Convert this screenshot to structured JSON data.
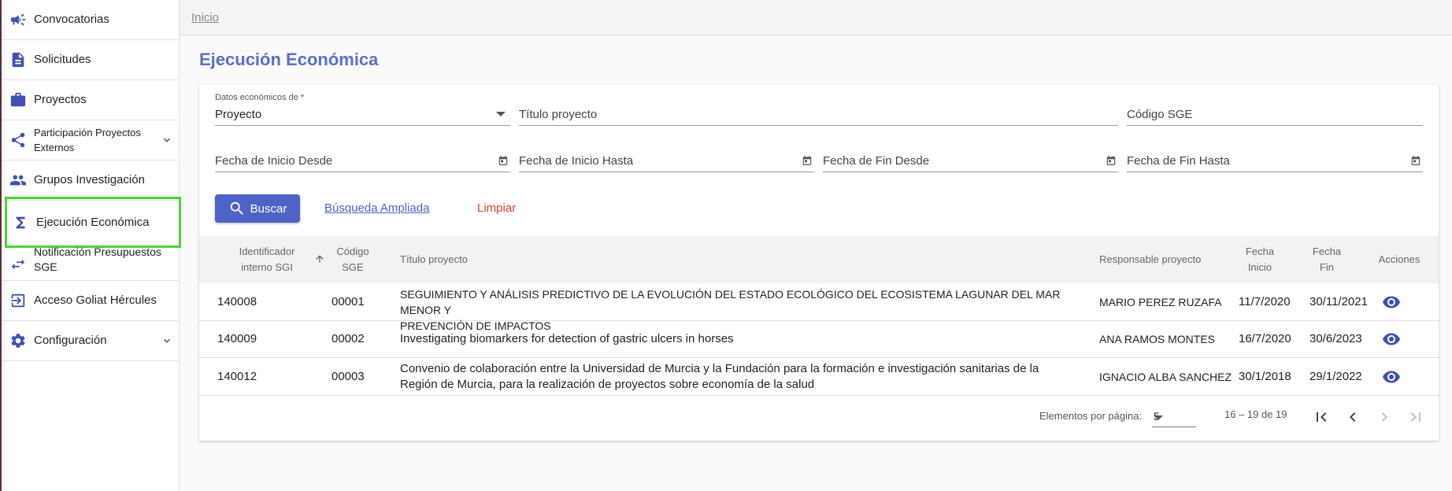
{
  "sidebar": {
    "items": [
      {
        "label": "Convocatorias"
      },
      {
        "label": "Solicitudes"
      },
      {
        "label": "Proyectos"
      },
      {
        "label": "Participación Proyectos Externos"
      },
      {
        "label": "Grupos Investigación"
      },
      {
        "label": "Ejecución Económica"
      },
      {
        "label": "Notificación Presupuestos SGE"
      },
      {
        "label": "Acceso Goliat Hércules"
      },
      {
        "label": "Configuración"
      }
    ]
  },
  "breadcrumb": {
    "home": "Inicio"
  },
  "page": {
    "title": "Ejecución Económica"
  },
  "filters": {
    "datos_label": "Datos económicos de *",
    "datos_value": "Proyecto",
    "titulo_placeholder": "Título proyecto",
    "codigo_placeholder": "Código SGE",
    "inicio_desde": "Fecha de Inicio Desde",
    "inicio_hasta": "Fecha de Inicio Hasta",
    "fin_desde": "Fecha de Fin Desde",
    "fin_hasta": "Fecha de Fin Hasta"
  },
  "actions": {
    "buscar": "Buscar",
    "ampliada": "Búsqueda Ampliada",
    "limpiar": "Limpiar"
  },
  "table": {
    "headers": {
      "id_1": "Identificador",
      "id_2": "interno SGI",
      "codigo_1": "Código",
      "codigo_2": "SGE",
      "titulo": "Título proyecto",
      "responsable": "Responsable proyecto",
      "inicio_1": "Fecha",
      "inicio_2": "Inicio",
      "fin_1": "Fecha",
      "fin_2": "Fin",
      "acciones": "Acciones"
    },
    "rows": [
      {
        "id": "140008",
        "codigo": "00001",
        "titulo_1": "SEGUIMIENTO Y ANÁLISIS PREDICTIVO DE LA EVOLUCIÓN DEL ESTADO ECOLÓGICO DEL ECOSISTEMA LAGUNAR DEL MAR MENOR Y",
        "titulo_2": "PREVENCIÓN DE IMPACTOS",
        "responsable": "MARIO PEREZ RUZAFA",
        "inicio": "11/7/2020",
        "fin": "30/11/2021"
      },
      {
        "id": "140009",
        "codigo": "00002",
        "titulo_1": "Investigating biomarkers for detection of gastric ulcers in horses",
        "titulo_2": "",
        "responsable": "ANA RAMOS MONTES",
        "inicio": "16/7/2020",
        "fin": "30/6/2023"
      },
      {
        "id": "140012",
        "codigo": "00003",
        "titulo_1": "Convenio de colaboración entre la Universidad de Murcia y la Fundación para la formación e investigación sanitarias de la",
        "titulo_2": "Región de Murcia, para la realización de proyectos sobre economía de la salud",
        "responsable": "IGNACIO ALBA SANCHEZ",
        "inicio": "30/1/2018",
        "fin": "29/1/2022"
      }
    ]
  },
  "paginator": {
    "label": "Elementos por página:",
    "page_size": "5",
    "range": "16 – 19 de 19"
  },
  "colors": {
    "accent": "#4d63c8",
    "title": "#5a6fc8",
    "danger": "#e53935",
    "active_outline": "#4bd334"
  }
}
